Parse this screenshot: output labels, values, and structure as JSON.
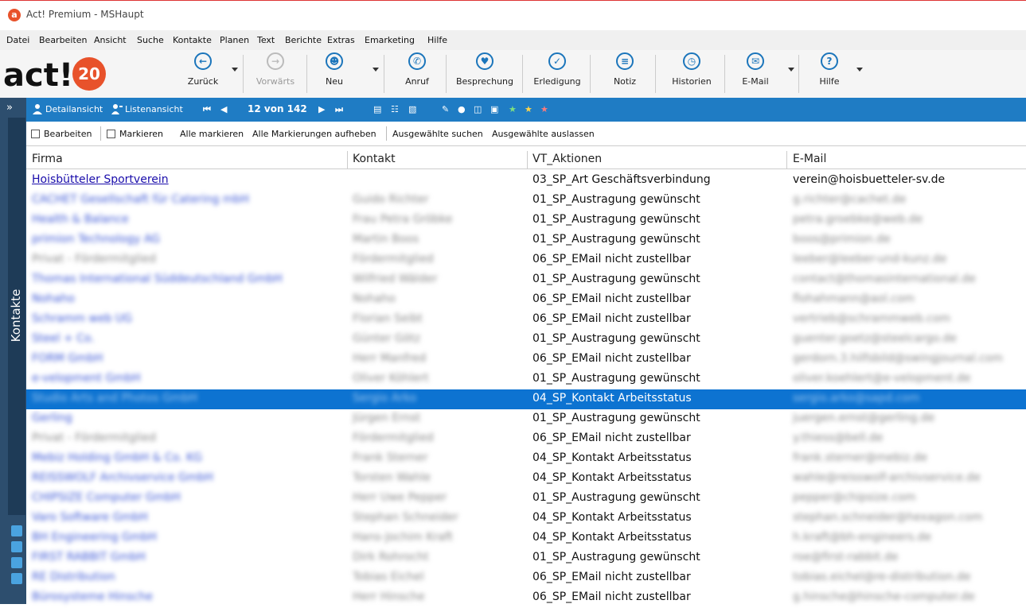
{
  "window": {
    "title": "Act! Premium - MSHaupt",
    "logo_letter": "a"
  },
  "menu": [
    "Datei",
    "Bearbeiten",
    "Ansicht",
    "Suche",
    "Kontakte",
    "Planen",
    "Text",
    "Berichte",
    "Extras",
    "Emarketing",
    "Hilfe"
  ],
  "toolbar": {
    "brand": "act!",
    "version": "20",
    "buttons": [
      {
        "label": "Zurück",
        "icon": "back-arrow-icon"
      },
      {
        "label": "Vorwärts",
        "icon": "forward-arrow-icon"
      },
      {
        "label": "Neu",
        "icon": "new-contact-icon"
      },
      {
        "label": "Anruf",
        "icon": "phone-icon"
      },
      {
        "label": "Besprechung",
        "icon": "meeting-icon"
      },
      {
        "label": "Erledigung",
        "icon": "todo-icon"
      },
      {
        "label": "Notiz",
        "icon": "note-icon"
      },
      {
        "label": "Historien",
        "icon": "history-icon"
      },
      {
        "label": "E-Mail",
        "icon": "email-icon"
      },
      {
        "label": "Hilfe",
        "icon": "help-icon"
      }
    ]
  },
  "sidebar": {
    "label": "Kontakte",
    "expand_glyph": "»"
  },
  "navbar": {
    "detail_view": "Detailansicht",
    "list_view": "Listenansicht",
    "record_position": "12 von 142"
  },
  "actionbar": {
    "edit": "Bearbeiten",
    "mark": "Markieren",
    "mark_all": "Alle markieren",
    "unmark_all": "Alle Markierungen aufheben",
    "search_selected": "Ausgewählte suchen",
    "omit_selected": "Ausgewählte auslassen"
  },
  "table": {
    "columns": [
      "Firma",
      "Kontakt",
      "VT_Aktionen",
      "E-Mail"
    ],
    "selected_row": 11,
    "rows": [
      {
        "firma": "Hoisbütteler Sportverein",
        "kontakt": "",
        "aktion": "03_SP_Art Geschäftsverbindung",
        "email": "verein@hoisbuetteler-sv.de",
        "clear": true
      },
      {
        "firma": "CACHET Gesellschaft für Catering mbH",
        "kontakt": "Guido Richter",
        "aktion": "01_SP_Austragung gewünscht",
        "email": "g.richter@cachet.de"
      },
      {
        "firma": "Health & Balance",
        "kontakt": "Frau Petra Gröbke",
        "aktion": "01_SP_Austragung gewünscht",
        "email": "petra.groebke@web.de"
      },
      {
        "firma": "primion Technology AG",
        "kontakt": "Martin Boos",
        "aktion": "01_SP_Austragung gewünscht",
        "email": "boos@primion.de"
      },
      {
        "firma": "Privat - Fördermitglied",
        "kontakt": "Fördermitglied",
        "aktion": "06_SP_EMail nicht zustellbar",
        "email": "leeber@leeber-und-kunz.de",
        "plain": true
      },
      {
        "firma": "Thomas International Süddeutschland GmbH",
        "kontakt": "Wilfried Wälder",
        "aktion": "01_SP_Austragung gewünscht",
        "email": "contact@thomasinternational.de"
      },
      {
        "firma": "Nohaho",
        "kontakt": "Nohaho",
        "aktion": "06_SP_EMail nicht zustellbar",
        "email": "flohahmann@aol.com"
      },
      {
        "firma": "Schramm web UG",
        "kontakt": "Florian Seibt",
        "aktion": "06_SP_EMail nicht zustellbar",
        "email": "vertrieb@schrammweb.com"
      },
      {
        "firma": "Steel + Co.",
        "kontakt": "Günter Götz",
        "aktion": "01_SP_Austragung gewünscht",
        "email": "guenter.goetz@steelcargo.de"
      },
      {
        "firma": "FORM GmbH",
        "kontakt": "Herr Manfred",
        "aktion": "06_SP_EMail nicht zustellbar",
        "email": "gerdorn.3.hilfsbild@swingjournal.com"
      },
      {
        "firma": "e-velopment GmbH",
        "kontakt": "Oliver Köhlert",
        "aktion": "01_SP_Austragung gewünscht",
        "email": "oliver.koehlert@e-velopment.de"
      },
      {
        "firma": "Studio Arts and Photos GmbH",
        "kontakt": "Sergio Arko",
        "aktion": "04_SP_Kontakt Arbeitsstatus",
        "email": "sergio.arko@sapd.com"
      },
      {
        "firma": "Gerling",
        "kontakt": "Jürgen Ernst",
        "aktion": "01_SP_Austragung gewünscht",
        "email": "juergen.ernst@gerling.de"
      },
      {
        "firma": "Privat - Fördermitglied",
        "kontakt": "Fördermitglied",
        "aktion": "06_SP_EMail nicht zustellbar",
        "email": "y.thiess@bell.de",
        "plain": true
      },
      {
        "firma": "Mebiz Holding GmbH & Co. KG",
        "kontakt": "Frank Sterner",
        "aktion": "04_SP_Kontakt Arbeitsstatus",
        "email": "frank.sterner@mebiz.de"
      },
      {
        "firma": "REISSWOLF Archivservice GmbH",
        "kontakt": "Torsten Wahle",
        "aktion": "04_SP_Kontakt Arbeitsstatus",
        "email": "wahle@reisswolf-archivservice.de"
      },
      {
        "firma": "CHIPSIZE Computer GmbH",
        "kontakt": "Herr Uwe Pepper",
        "aktion": "01_SP_Austragung gewünscht",
        "email": "pepper@chipsize.com"
      },
      {
        "firma": "Varo Software GmbH",
        "kontakt": "Stephan Schneider",
        "aktion": "04_SP_Kontakt Arbeitsstatus",
        "email": "stephan.schneider@hexagon.com"
      },
      {
        "firma": "BH Engineering GmbH",
        "kontakt": "Hans-Jochim Kraft",
        "aktion": "04_SP_Kontakt Arbeitsstatus",
        "email": "h.kraft@bh-engineers.de"
      },
      {
        "firma": "FIRST RABBIT GmbH",
        "kontakt": "Dirk Rohrocht",
        "aktion": "01_SP_Austragung gewünscht",
        "email": "roe@first-rabbit.de"
      },
      {
        "firma": "RE Distribution",
        "kontakt": "Tobias Eichel",
        "aktion": "06_SP_EMail nicht zustellbar",
        "email": "tobias.eichel@re-distribution.de"
      },
      {
        "firma": "Bürosysteme Hinsche",
        "kontakt": "Herr Hinsche",
        "aktion": "06_SP_EMail nicht zustellbar",
        "email": "g.hinsche@hinsche-computer.de"
      }
    ]
  },
  "colors": {
    "accent": "#1f7cc4",
    "selection": "#0d73d1",
    "sidebar": "#2d4e6e"
  }
}
